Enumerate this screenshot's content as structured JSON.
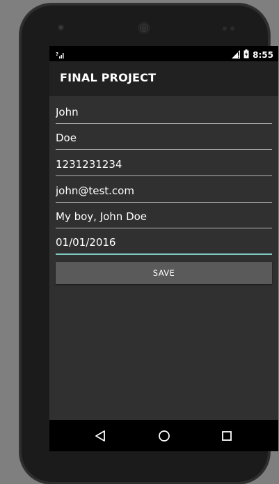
{
  "status_bar": {
    "time": "8:55",
    "icons": [
      "sim-unknown-icon",
      "signal-icon",
      "battery-icon"
    ]
  },
  "app_bar": {
    "title": "FINAL PROJECT"
  },
  "form": {
    "first_name": "John",
    "last_name": "Doe",
    "phone": "1231231234",
    "email": "john@test.com",
    "note": "My boy, John Doe",
    "date": "01/01/2016",
    "save_label": "SAVE"
  },
  "nav_bar": {
    "buttons": [
      "back-icon",
      "home-icon",
      "recents-icon"
    ]
  },
  "colors": {
    "background": "#303030",
    "app_bar": "#212121",
    "accent": "#7fcbc4",
    "button": "#5a5a5a"
  }
}
